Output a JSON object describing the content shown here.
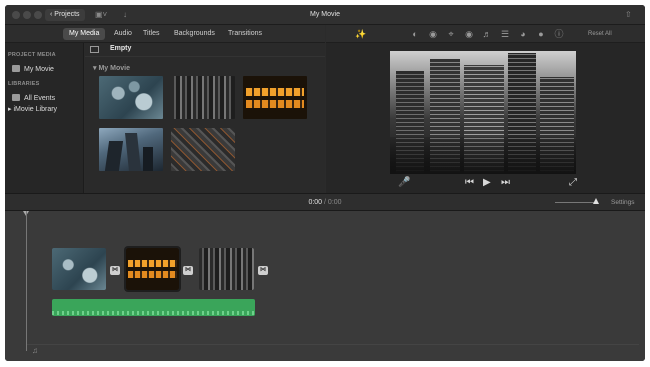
{
  "window": {
    "title": "My Movie",
    "projects_label": "‹ Projects"
  },
  "browser_tabs": [
    {
      "label": "My Media",
      "active": true
    },
    {
      "label": "Audio",
      "active": false
    },
    {
      "label": "Titles",
      "active": false
    },
    {
      "label": "Backgrounds",
      "active": false
    },
    {
      "label": "Transitions",
      "active": false
    }
  ],
  "viewer_toolbar": {
    "icons": [
      "magic-wand-icon",
      "color-balance-icon",
      "color-correction-icon",
      "crop-icon",
      "stabilization-icon",
      "volume-icon",
      "noise-reduction-icon",
      "speed-icon",
      "clip-filter-icon",
      "info-icon"
    ],
    "reset_label": "Reset All"
  },
  "sidebar": {
    "project_media_heading": "PROJECT MEDIA",
    "project_item": "My Movie",
    "libraries_heading": "LIBRARIES",
    "all_events": "All Events",
    "library_item": "iMovie Library"
  },
  "media_browser": {
    "filter_label": "Empty",
    "event_title": "▾ My Movie",
    "thumbnails": [
      "ocean-waves",
      "city-skyline",
      "night-windows",
      "skyscrapers-sky",
      "aerial-city"
    ]
  },
  "timebar": {
    "current_time": "0:00",
    "separator": " / ",
    "duration": "0:00",
    "settings_label": "Settings"
  },
  "timeline": {
    "clips": [
      "ocean-waves",
      "night-windows",
      "city-skyline"
    ],
    "transition_symbol": "⋈"
  },
  "colors": {
    "accent_audio": "#3aa55a",
    "background": "#2b2b2b"
  }
}
